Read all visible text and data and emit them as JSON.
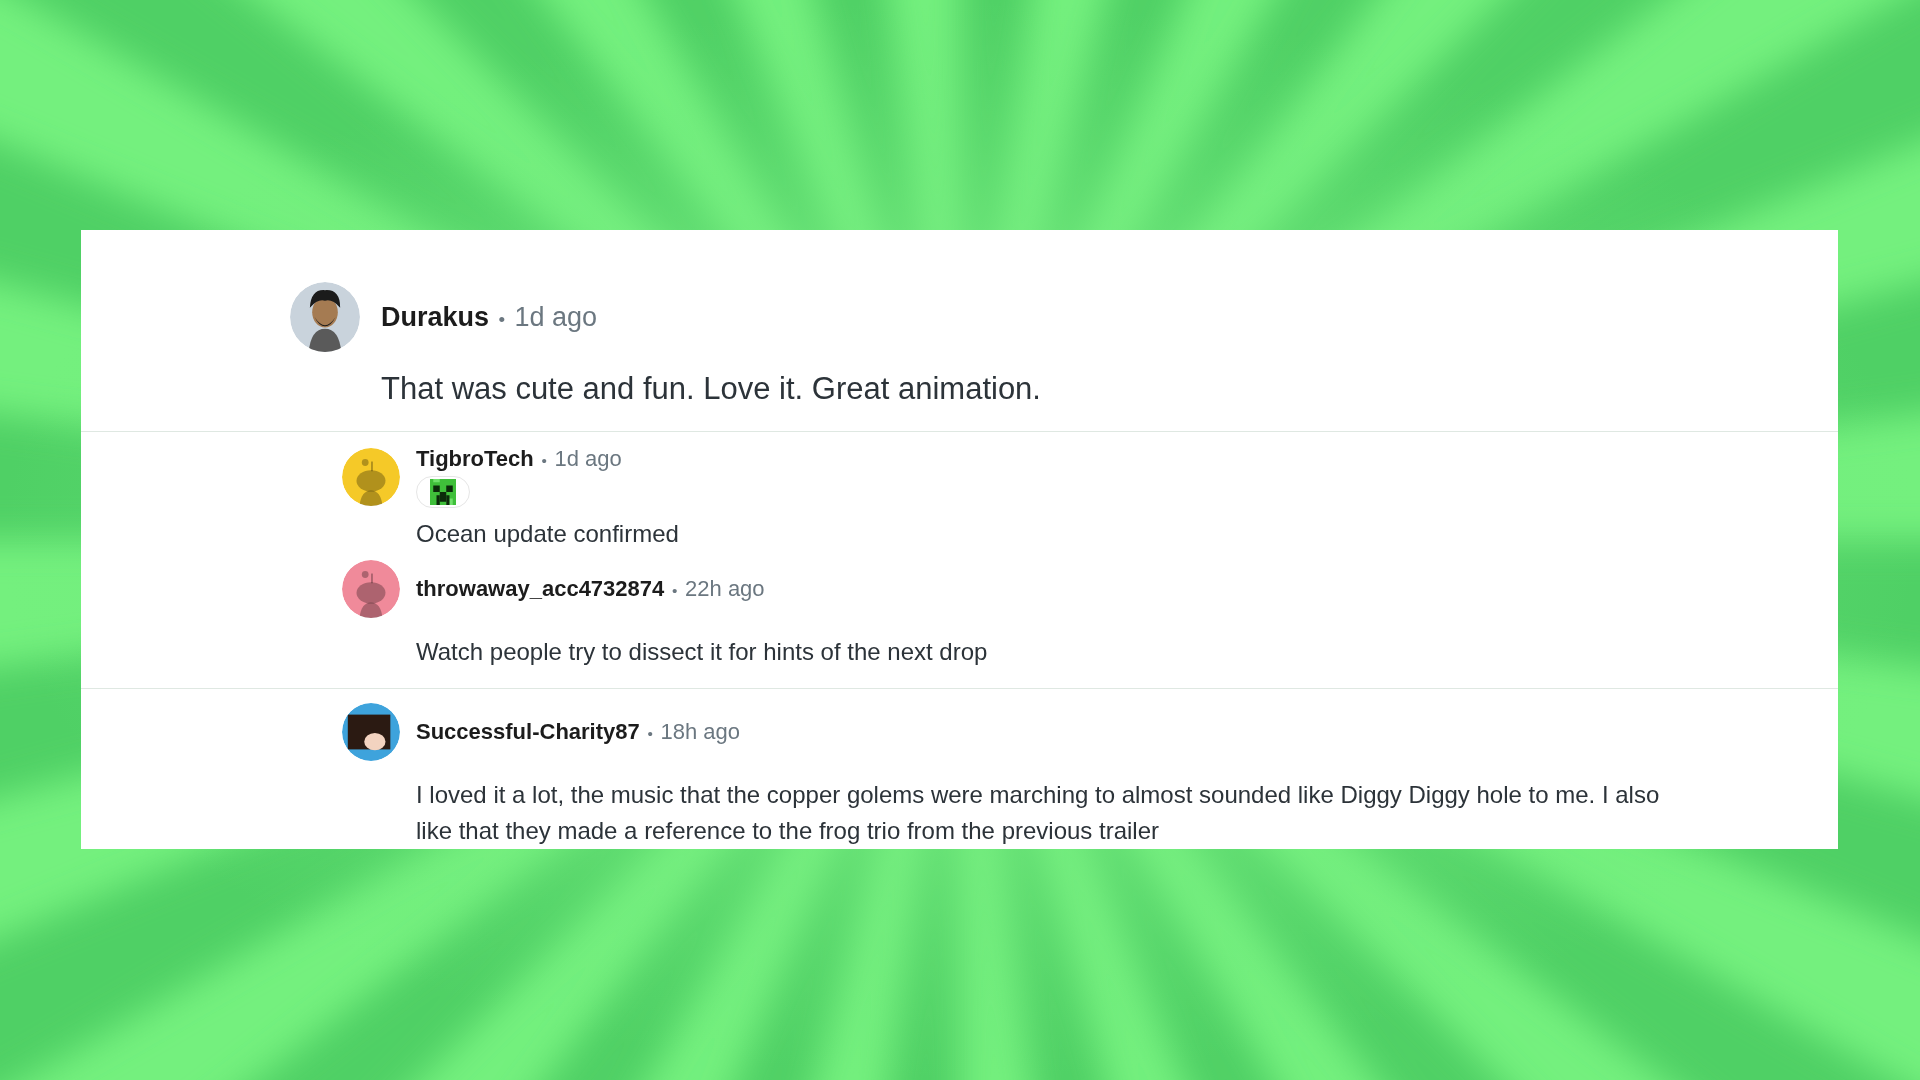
{
  "comment": {
    "author": "Durakus",
    "separator": "•",
    "time": "1d ago",
    "body": "That was cute and fun. Love it. Great animation.",
    "avatar": {
      "kind": "figure",
      "color": "#c9d3dc"
    },
    "children": [
      {
        "author": "TigbroTech",
        "separator": "•",
        "time": "1d ago",
        "body": "Ocean update confirmed",
        "flair": true,
        "avatar": {
          "kind": "snoo",
          "color": "#f5c928"
        },
        "children": [
          {
            "author": "throwaway_acc4732874",
            "separator": "•",
            "time": "22h ago",
            "body": "Watch people try to dissect it for hints of the next drop",
            "avatar": {
              "kind": "snoo",
              "color": "#f08a9a"
            }
          }
        ]
      },
      {
        "author": "Successful-Charity87",
        "separator": "•",
        "time": "18h ago",
        "body": "I loved it a lot, the music that the copper golems were marching to almost sounded like Diggy Diggy hole to me. I also like that they made a reference to the frog trio from the previous trailer",
        "avatar": {
          "kind": "hair",
          "color": "#3ea3dc"
        }
      }
    ]
  }
}
